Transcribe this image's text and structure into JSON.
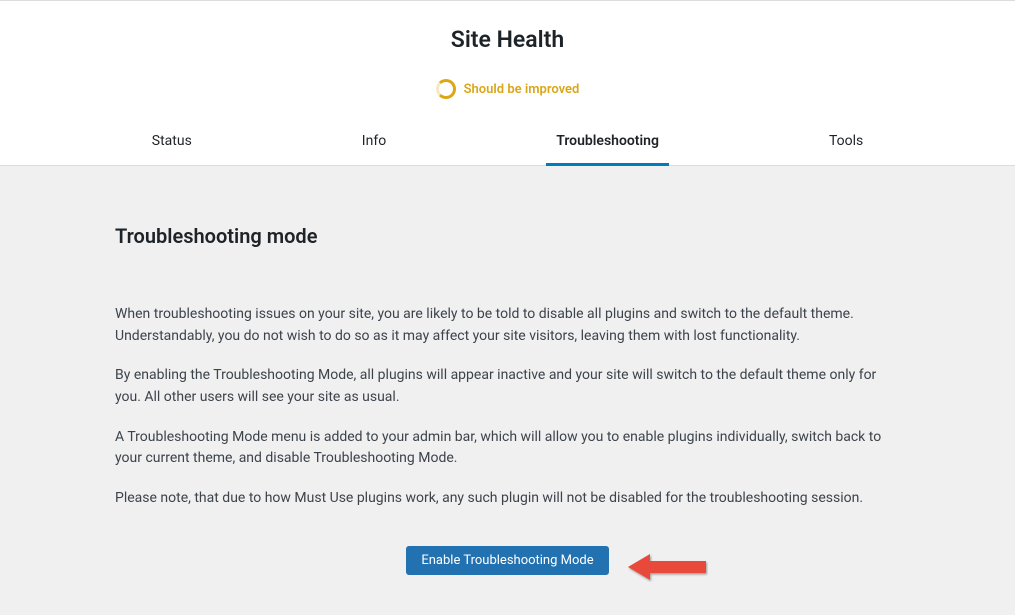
{
  "header": {
    "title": "Site Health",
    "status_label": "Should be improved",
    "status_color": "#dba617"
  },
  "tabs": [
    {
      "label": "Status",
      "active": false
    },
    {
      "label": "Info",
      "active": false
    },
    {
      "label": "Troubleshooting",
      "active": true
    },
    {
      "label": "Tools",
      "active": false
    }
  ],
  "content": {
    "title": "Troubleshooting mode",
    "paragraphs": [
      "When troubleshooting issues on your site, you are likely to be told to disable all plugins and switch to the default theme. Understandably, you do not wish to do so as it may affect your site visitors, leaving them with lost functionality.",
      "By enabling the Troubleshooting Mode, all plugins will appear inactive and your site will switch to the default theme only for you. All other users will see your site as usual.",
      "A Troubleshooting Mode menu is added to your admin bar, which will allow you to enable plugins individually, switch back to your current theme, and disable Troubleshooting Mode.",
      "Please note, that due to how Must Use plugins work, any such plugin will not be disabled for the troubleshooting session."
    ],
    "button_label": "Enable Troubleshooting Mode"
  }
}
